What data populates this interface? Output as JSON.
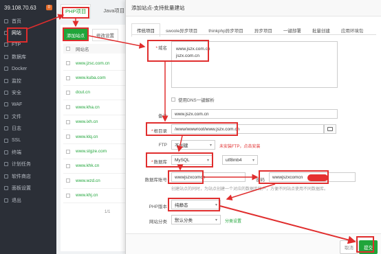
{
  "sidebar": {
    "host": "39.108.70.63",
    "badge": "0",
    "items": [
      {
        "label": "首页",
        "icon": "home-icon"
      },
      {
        "label": "网站",
        "icon": "globe-icon"
      },
      {
        "label": "FTP",
        "icon": "ftp-icon"
      },
      {
        "label": "数据库",
        "icon": "database-icon"
      },
      {
        "label": "Docker",
        "icon": "docker-icon"
      },
      {
        "label": "监控",
        "icon": "monitor-icon"
      },
      {
        "label": "安全",
        "icon": "shield-icon"
      },
      {
        "label": "WAF",
        "icon": "firewall-icon"
      },
      {
        "label": "文件",
        "icon": "folder-icon"
      },
      {
        "label": "日志",
        "icon": "log-icon"
      },
      {
        "label": "SSL",
        "icon": "lock-icon"
      },
      {
        "label": "终端",
        "icon": "terminal-icon"
      },
      {
        "label": "计划任务",
        "icon": "clock-icon"
      },
      {
        "label": "软件商店",
        "icon": "store-icon"
      },
      {
        "label": "面板设置",
        "icon": "gear-icon"
      },
      {
        "label": "退出",
        "icon": "logout-icon"
      }
    ]
  },
  "main": {
    "tabs": [
      "PHP项目",
      "Java项目"
    ],
    "add_button": "添加站点",
    "group_button": "修改设置",
    "list_header": "网站名",
    "sites": [
      "www.jzsc.com.cn",
      "www.kuba.com",
      "dcut.cn",
      "www.kha.cn",
      "www.ixh.cn",
      "www.klq.cn",
      "www.stgze.com",
      "www.khk.cn",
      "www.wzd.cn",
      "www.khj.cn"
    ],
    "pager": "1/1"
  },
  "modal": {
    "title": "添加站点-支持批量建站",
    "tabs": [
      "传统项目",
      "swoole异步项目",
      "thinkphp异步项目",
      "异步项目",
      "一键部署",
      "批量创建",
      "应用环境包"
    ],
    "domain_label": "域名",
    "domain_lines": [
      "www.jszx.com.cn",
      "jszx.com.cn"
    ],
    "dns_label": "使用DNS一键解析",
    "remark_label": "备注",
    "remark_value": "www.jszx.com.cn",
    "root_label": "根目录",
    "root_value": "/www/wwwroot/www.jszx.com.cn",
    "ftp_label": "FTP",
    "ftp_value": "不创建",
    "ftp_warning": "未安装FTP，点击安装",
    "db_label": "数据库",
    "db_value": "MySQL",
    "charset_value": "utf8mb4",
    "db_account_label": "数据库账号",
    "db_account_value": "wwwjszxcomcn",
    "password_label": "密码",
    "password_value": "wwwjszxcomcn",
    "db_note": "创建站点的同时，为站点创建一个对应的数据库帐户，方便不同站点使用不同数据库。",
    "php_label": "PHP版本",
    "php_value": "纯静态",
    "category_label": "网站分类",
    "category_value": "默认分类",
    "category_link": "分类设置",
    "cancel": "取消",
    "submit": "提交"
  }
}
